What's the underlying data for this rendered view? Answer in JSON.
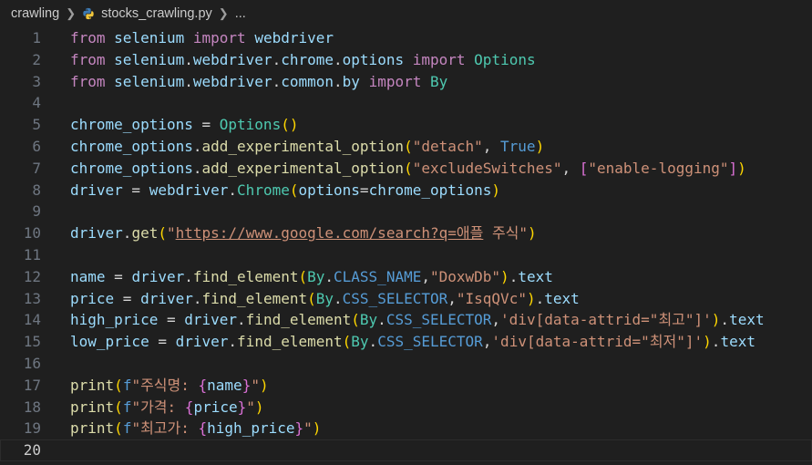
{
  "breadcrumb": {
    "folder": "crawling",
    "file": "stocks_crawling.py",
    "more": "..."
  },
  "lines": [
    {
      "n": "1",
      "tokens": [
        [
          "kw",
          "from"
        ],
        [
          "op",
          " "
        ],
        [
          "id",
          "selenium"
        ],
        [
          "op",
          " "
        ],
        [
          "kw",
          "import"
        ],
        [
          "op",
          " "
        ],
        [
          "id",
          "webdriver"
        ]
      ]
    },
    {
      "n": "2",
      "tokens": [
        [
          "kw",
          "from"
        ],
        [
          "op",
          " "
        ],
        [
          "id",
          "selenium"
        ],
        [
          "op",
          "."
        ],
        [
          "id",
          "webdriver"
        ],
        [
          "op",
          "."
        ],
        [
          "id",
          "chrome"
        ],
        [
          "op",
          "."
        ],
        [
          "id",
          "options"
        ],
        [
          "op",
          " "
        ],
        [
          "kw",
          "import"
        ],
        [
          "op",
          " "
        ],
        [
          "cls",
          "Options"
        ]
      ]
    },
    {
      "n": "3",
      "tokens": [
        [
          "kw",
          "from"
        ],
        [
          "op",
          " "
        ],
        [
          "id",
          "selenium"
        ],
        [
          "op",
          "."
        ],
        [
          "id",
          "webdriver"
        ],
        [
          "op",
          "."
        ],
        [
          "id",
          "common"
        ],
        [
          "op",
          "."
        ],
        [
          "id",
          "by"
        ],
        [
          "op",
          " "
        ],
        [
          "kw",
          "import"
        ],
        [
          "op",
          " "
        ],
        [
          "cls",
          "By"
        ]
      ]
    },
    {
      "n": "4",
      "tokens": []
    },
    {
      "n": "5",
      "tokens": [
        [
          "id",
          "chrome_options"
        ],
        [
          "op",
          " = "
        ],
        [
          "cls",
          "Options"
        ],
        [
          "b1",
          "()"
        ]
      ]
    },
    {
      "n": "6",
      "tokens": [
        [
          "id",
          "chrome_options"
        ],
        [
          "op",
          "."
        ],
        [
          "fn",
          "add_experimental_option"
        ],
        [
          "b1",
          "("
        ],
        [
          "str",
          "\"detach\""
        ],
        [
          "op",
          ", "
        ],
        [
          "const",
          "True"
        ],
        [
          "b1",
          ")"
        ]
      ]
    },
    {
      "n": "7",
      "tokens": [
        [
          "id",
          "chrome_options"
        ],
        [
          "op",
          "."
        ],
        [
          "fn",
          "add_experimental_option"
        ],
        [
          "b1",
          "("
        ],
        [
          "str",
          "\"excludeSwitches\""
        ],
        [
          "op",
          ", "
        ],
        [
          "b2",
          "["
        ],
        [
          "str",
          "\"enable-logging\""
        ],
        [
          "b2",
          "]"
        ],
        [
          "b1",
          ")"
        ]
      ]
    },
    {
      "n": "8",
      "tokens": [
        [
          "id",
          "driver"
        ],
        [
          "op",
          " = "
        ],
        [
          "id",
          "webdriver"
        ],
        [
          "op",
          "."
        ],
        [
          "cls",
          "Chrome"
        ],
        [
          "b1",
          "("
        ],
        [
          "id",
          "options"
        ],
        [
          "op",
          "="
        ],
        [
          "id",
          "chrome_options"
        ],
        [
          "b1",
          ")"
        ]
      ]
    },
    {
      "n": "9",
      "tokens": []
    },
    {
      "n": "10",
      "tokens": [
        [
          "id",
          "driver"
        ],
        [
          "op",
          "."
        ],
        [
          "fn",
          "get"
        ],
        [
          "b1",
          "("
        ],
        [
          "str",
          "\""
        ],
        [
          "url",
          "https://www.google.com/search?q=애플"
        ],
        [
          "str",
          " 주식\""
        ],
        [
          "b1",
          ")"
        ]
      ]
    },
    {
      "n": "11",
      "tokens": []
    },
    {
      "n": "12",
      "tokens": [
        [
          "id",
          "name"
        ],
        [
          "op",
          " = "
        ],
        [
          "id",
          "driver"
        ],
        [
          "op",
          "."
        ],
        [
          "fn",
          "find_element"
        ],
        [
          "b1",
          "("
        ],
        [
          "cls",
          "By"
        ],
        [
          "op",
          "."
        ],
        [
          "const",
          "CLASS_NAME"
        ],
        [
          "op",
          ","
        ],
        [
          "str",
          "\"DoxwDb\""
        ],
        [
          "b1",
          ")"
        ],
        [
          "op",
          "."
        ],
        [
          "id",
          "text"
        ]
      ]
    },
    {
      "n": "13",
      "tokens": [
        [
          "id",
          "price"
        ],
        [
          "op",
          " = "
        ],
        [
          "id",
          "driver"
        ],
        [
          "op",
          "."
        ],
        [
          "fn",
          "find_element"
        ],
        [
          "b1",
          "("
        ],
        [
          "cls",
          "By"
        ],
        [
          "op",
          "."
        ],
        [
          "const",
          "CSS_SELECTOR"
        ],
        [
          "op",
          ","
        ],
        [
          "str",
          "\"IsqQVc\""
        ],
        [
          "b1",
          ")"
        ],
        [
          "op",
          "."
        ],
        [
          "id",
          "text"
        ]
      ]
    },
    {
      "n": "14",
      "tokens": [
        [
          "id",
          "high_price"
        ],
        [
          "op",
          " = "
        ],
        [
          "id",
          "driver"
        ],
        [
          "op",
          "."
        ],
        [
          "fn",
          "find_element"
        ],
        [
          "b1",
          "("
        ],
        [
          "cls",
          "By"
        ],
        [
          "op",
          "."
        ],
        [
          "const",
          "CSS_SELECTOR"
        ],
        [
          "op",
          ","
        ],
        [
          "str",
          "'div[data-attrid=\"최고\"]'"
        ],
        [
          "b1",
          ")"
        ],
        [
          "op",
          "."
        ],
        [
          "id",
          "text"
        ]
      ]
    },
    {
      "n": "15",
      "tokens": [
        [
          "id",
          "low_price"
        ],
        [
          "op",
          " = "
        ],
        [
          "id",
          "driver"
        ],
        [
          "op",
          "."
        ],
        [
          "fn",
          "find_element"
        ],
        [
          "b1",
          "("
        ],
        [
          "cls",
          "By"
        ],
        [
          "op",
          "."
        ],
        [
          "const",
          "CSS_SELECTOR"
        ],
        [
          "op",
          ","
        ],
        [
          "str",
          "'div[data-attrid=\"최저\"]'"
        ],
        [
          "b1",
          ")"
        ],
        [
          "op",
          "."
        ],
        [
          "id",
          "text"
        ]
      ]
    },
    {
      "n": "16",
      "tokens": []
    },
    {
      "n": "17",
      "tokens": [
        [
          "fn",
          "print"
        ],
        [
          "b1",
          "("
        ],
        [
          "const",
          "f"
        ],
        [
          "str",
          "\"주식명: "
        ],
        [
          "b2",
          "{"
        ],
        [
          "id",
          "name"
        ],
        [
          "b2",
          "}"
        ],
        [
          "str",
          "\""
        ],
        [
          "b1",
          ")"
        ]
      ]
    },
    {
      "n": "18",
      "tokens": [
        [
          "fn",
          "print"
        ],
        [
          "b1",
          "("
        ],
        [
          "const",
          "f"
        ],
        [
          "str",
          "\"가격: "
        ],
        [
          "b2",
          "{"
        ],
        [
          "id",
          "price"
        ],
        [
          "b2",
          "}"
        ],
        [
          "str",
          "\""
        ],
        [
          "b1",
          ")"
        ]
      ]
    },
    {
      "n": "19",
      "tokens": [
        [
          "fn",
          "print"
        ],
        [
          "b1",
          "("
        ],
        [
          "const",
          "f"
        ],
        [
          "str",
          "\"최고가: "
        ],
        [
          "b2",
          "{"
        ],
        [
          "id",
          "high_price"
        ],
        [
          "b2",
          "}"
        ],
        [
          "str",
          "\""
        ],
        [
          "b1",
          ")"
        ]
      ]
    },
    {
      "n": "20",
      "tokens": []
    }
  ],
  "current_line": "20"
}
